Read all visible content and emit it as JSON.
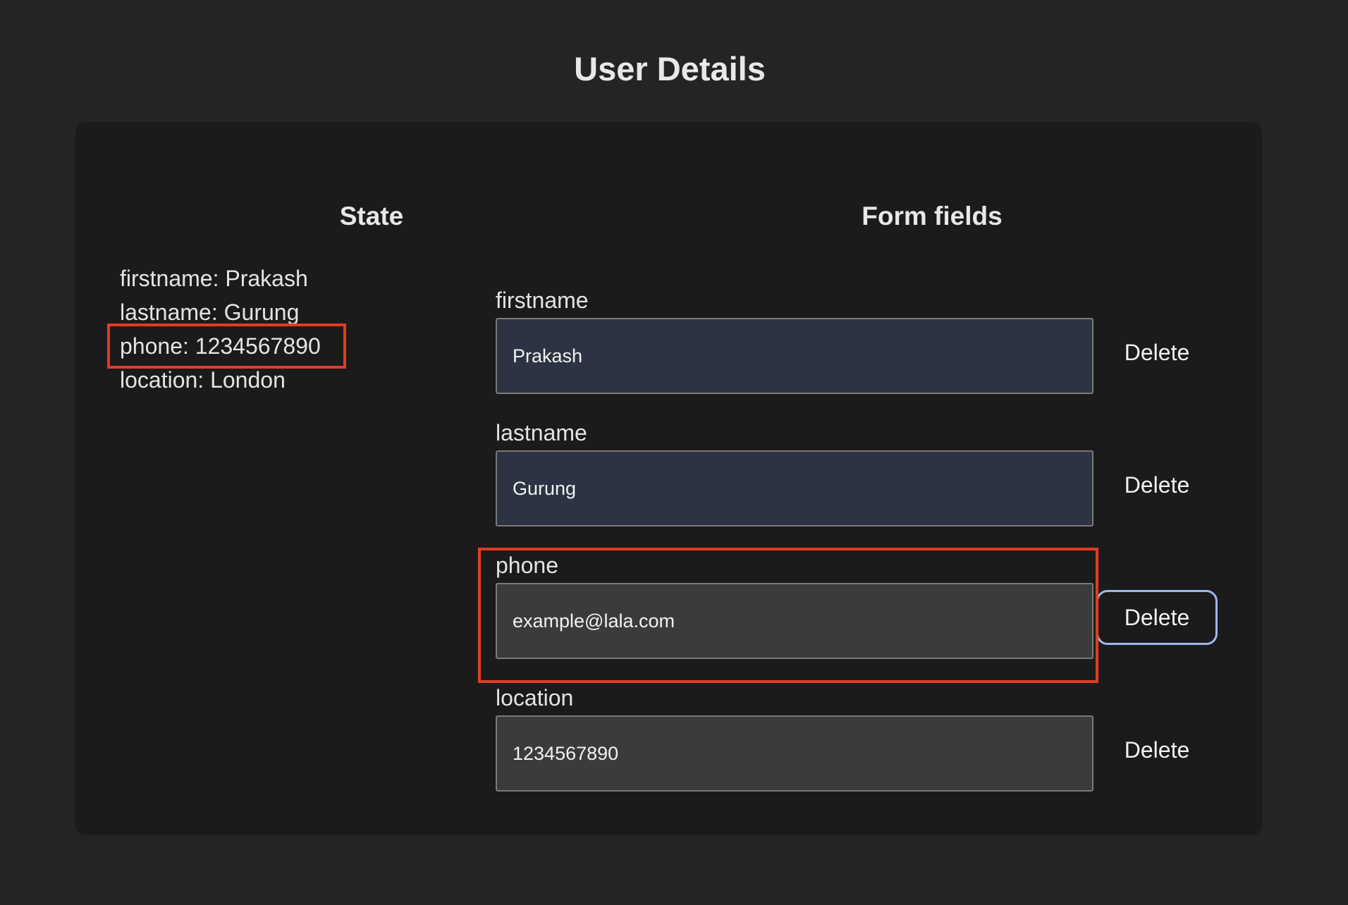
{
  "page": {
    "title": "User Details"
  },
  "state_panel": {
    "heading": "State",
    "rows": [
      "firstname: Prakash",
      "lastname: Gurung",
      "phone: 1234567890",
      "location: London"
    ]
  },
  "form_panel": {
    "heading": "Form fields",
    "fields": [
      {
        "label": "firstname",
        "value": "Prakash",
        "delete_label": "Delete"
      },
      {
        "label": "lastname",
        "value": "Gurung",
        "delete_label": "Delete"
      },
      {
        "label": "phone",
        "value": "example@lala.com",
        "delete_label": "Delete"
      },
      {
        "label": "location",
        "value": "1234567890",
        "delete_label": "Delete"
      }
    ]
  },
  "colors": {
    "background": "#242424",
    "panel": "#1b1b1b",
    "highlight": "#e23b24",
    "filled_input": "#2c3342",
    "plain_input": "#3b3b3b",
    "focus_ring": "#9db8ea"
  }
}
